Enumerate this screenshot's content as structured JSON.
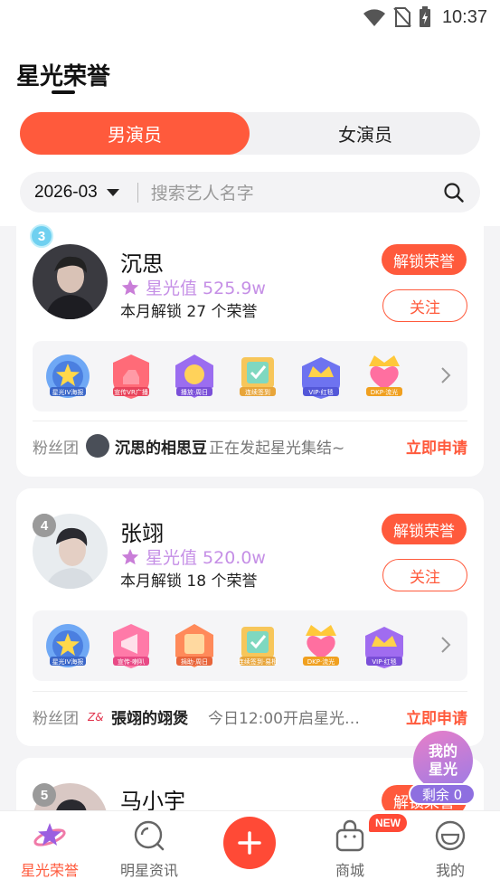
{
  "status_bar": {
    "time": "10:37"
  },
  "header": {
    "title": "星光荣誉",
    "tabs": [
      {
        "label": "男演员",
        "active": true
      },
      {
        "label": "女演员",
        "active": false
      }
    ],
    "filter": {
      "date": "2026-03",
      "search_placeholder": "搜索艺人名字"
    }
  },
  "artists": [
    {
      "rank": "3",
      "name": "沉思",
      "score": "星光值 525.9w",
      "unlock_text": "本月解锁 27 个荣誉",
      "unlock_button": "解锁荣誉",
      "follow_button": "关注",
      "badges": [
        "星光IV海报",
        "宣传VR广播",
        "播放·周日",
        "连续签到",
        "VIP·红毯",
        "DKP·流光"
      ],
      "fan": {
        "label": "粉丝团",
        "name": "沉思的相思豆",
        "desc": "正在发起星光集结~",
        "apply": "立即申请"
      }
    },
    {
      "rank": "4",
      "name": "张翊",
      "score": "星光值 520.0w",
      "unlock_text": "本月解锁 18 个荣誉",
      "unlock_button": "解锁荣誉",
      "follow_button": "关注",
      "badges": [
        "星光IV海报",
        "宣传·喇叭",
        "捐助·周日",
        "连续签到·易橙",
        "DKP·流光",
        "VIP·红毯"
      ],
      "fan": {
        "label": "粉丝团",
        "name": "張翊的翊煲",
        "desc": "今日12:00开启星光…",
        "apply": "立即申请"
      }
    },
    {
      "rank": "5",
      "name": "马小宇",
      "unlock_button": "解锁荣誉"
    }
  ],
  "floating": {
    "line1": "我的",
    "line2": "星光",
    "remain": "剩余 0"
  },
  "bottom_nav": [
    {
      "label": "星光荣誉",
      "icon": "star-planet-icon",
      "active": true
    },
    {
      "label": "明星资讯",
      "icon": "news-search-icon",
      "active": false
    },
    {
      "label": "",
      "icon": "plus-icon",
      "active": false
    },
    {
      "label": "商城",
      "icon": "shopping-bag-icon",
      "active": false,
      "badge": "NEW"
    },
    {
      "label": "我的",
      "icon": "smiley-icon",
      "active": false
    }
  ],
  "colors": {
    "accent": "#ff5a3c",
    "score": "#c58fe6",
    "float_gradient": [
      "#e87fc8",
      "#9b7be6"
    ]
  }
}
